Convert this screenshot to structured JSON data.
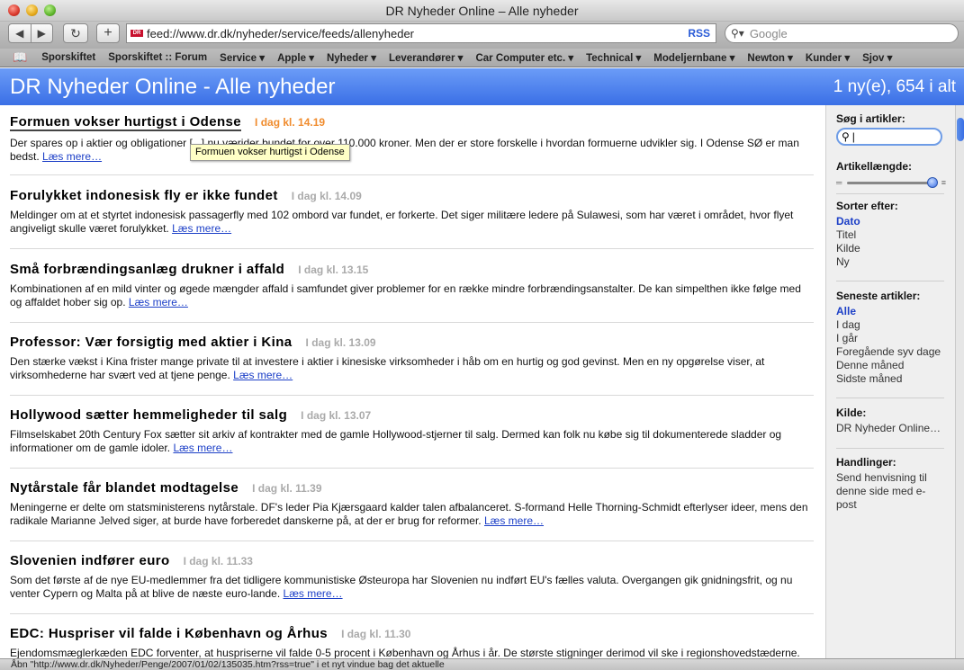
{
  "window": {
    "title": "DR Nyheder Online – Alle nyheder"
  },
  "toolbar": {
    "back": "◀",
    "forward": "▶",
    "reload": "↻",
    "add": "+",
    "url": "feed://www.dr.dk/nyheder/service/feeds/allenyheder",
    "rss_label": "RSS",
    "search_placeholder": "Google"
  },
  "bookmarks": [
    "Sporskiftet",
    "Sporskiftet :: Forum",
    "Service ▾",
    "Apple ▾",
    "Nyheder ▾",
    "Leverandører ▾",
    "Car Computer etc. ▾",
    "Technical ▾",
    "Modeljernbane ▾",
    "Newton ▾",
    "Kunder ▾",
    "Sjov ▾"
  ],
  "banner": {
    "title": "DR Nyheder Online - Alle nyheder",
    "count": "1 ny(e), 654 i alt"
  },
  "read_more": "Læs mere…",
  "articles": [
    {
      "title": "Formuen vokser hurtigst i Odense",
      "date": "I dag kl. 14.19",
      "body": "Der spares op i aktier og obligationer [...] nu værider bundet for over 110.000 kroner. Men der er store forskelle i hvordan formuerne udvikler sig. I Odense SØ er man bedst."
    },
    {
      "title": "Forulykket indonesisk fly er ikke fundet",
      "date": "I dag kl. 14.09",
      "body": "Meldinger om at et styrtet indonesisk passagerfly med 102 ombord var fundet, er forkerte. Det siger militære ledere på Sulawesi, som har været i området, hvor flyet angiveligt skulle været forulykket."
    },
    {
      "title": "Små forbrændingsanlæg drukner i affald",
      "date": "I dag kl. 13.15",
      "body": "Kombinationen af en mild vinter og øgede mængder affald i samfundet giver problemer for en række mindre forbrændingsanstalter. De kan simpelthen ikke følge med og affaldet hober sig op."
    },
    {
      "title": "Professor: Vær forsigtig med aktier i Kina",
      "date": "I dag kl. 13.09",
      "body": "Den stærke vækst i Kina frister mange private til at investere i aktier i kinesiske virksomheder i håb om en hurtig og god gevinst. Men en ny opgørelse viser, at virksomhederne har svært ved at tjene penge."
    },
    {
      "title": "Hollywood sætter hemmeligheder til salg",
      "date": "I dag kl. 13.07",
      "body": "Filmselskabet 20th Century Fox sætter sit arkiv af kontrakter med de gamle Hollywood-stjerner til salg. Dermed kan folk nu købe sig til dokumenterede sladder og informationer om de gamle idoler."
    },
    {
      "title": "Nytårstale får blandet modtagelse",
      "date": "I dag kl. 11.39",
      "body": "Meningerne er delte om statsministerens nytårstale. DF's leder Pia Kjærsgaard kalder talen afbalanceret. S-formand Helle Thorning-Schmidt efterlyser ideer, mens den radikale Marianne Jelved siger, at burde have forberedet danskerne på, at der er brug for reformer."
    },
    {
      "title": "Slovenien indfører euro",
      "date": "I dag kl. 11.33",
      "body": "Som det første af de nye EU-medlemmer fra det tidligere kommunistiske Østeuropa har Slovenien nu indført EU's fælles valuta. Overgangen gik gnidningsfrit, og nu venter Cypern og Malta på at blive de næste euro-lande."
    },
    {
      "title": "EDC: Huspriser vil falde i København og Århus",
      "date": "I dag kl. 11.30",
      "body": "Ejendomsmæglerkæden EDC forventer, at huspriserne vil falde 0-5 procent i København og Århus i år. De største stigninger derimod vil ske i regionshovedstæderne."
    }
  ],
  "tooltip": "Formuen vokser hurtigst i Odense",
  "sidebar": {
    "search_heading": "Søg i artikler:",
    "length_heading": "Artikellængde:",
    "sort_heading": "Sorter efter:",
    "sort_options": [
      "Dato",
      "Titel",
      "Kilde",
      "Ny"
    ],
    "recent_heading": "Seneste artikler:",
    "recent_options": [
      "Alle",
      "I dag",
      "I går",
      "Foregående syv dage",
      "Denne måned",
      "Sidste måned"
    ],
    "source_heading": "Kilde:",
    "source_value": "DR Nyheder Online…",
    "actions_heading": "Handlinger:",
    "actions_value": "Send henvisning til denne side med e-post"
  },
  "status": "Åbn \"http://www.dr.dk/Nyheder/Penge/2007/01/02/135035.htm?rss=true\" i et nyt vindue bag det aktuelle"
}
